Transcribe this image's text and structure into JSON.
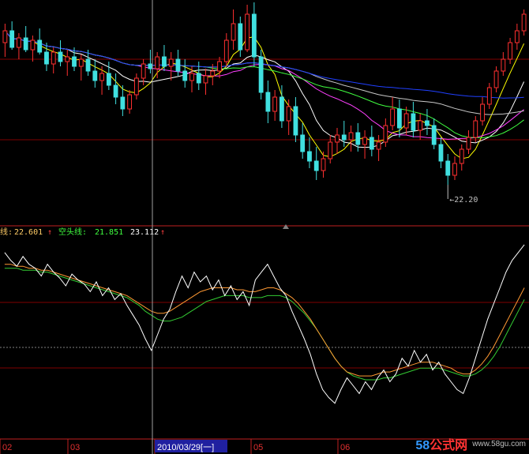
{
  "colors": {
    "background": "#000000",
    "grid_red": "#800000",
    "grid_gray": "#808080",
    "candle_up": "#ff3030",
    "candle_down": "#40e0e0",
    "ma_white": "#ffffff",
    "ma_yellow": "#ffff00",
    "ma_magenta": "#ff40ff",
    "ma_green": "#40ff40",
    "ma_gray": "#c8c8c8",
    "ma_blue": "#2040ff",
    "osc_white": "#ffffff",
    "osc_orange": "#ff9933",
    "osc_green": "#33cc33",
    "date_highlight": "#2020a0"
  },
  "indicator_bar": {
    "long_line_label": "线: ",
    "long_line_value": "22.601",
    "long_line_arrow": "↑",
    "short_line_label": "空头线: ",
    "short_line_value": "21.851",
    "third_value": "23.112",
    "third_arrow": "↑"
  },
  "price_annotation": "←22.20",
  "date_axis": {
    "labels": [
      "02",
      "03",
      "2010/03/29[一]",
      "05",
      "06"
    ],
    "highlighted": "2010/03/29[一]"
  },
  "watermark": {
    "brand_prefix": "58",
    "brand_suffix": "公式网",
    "url": "www.58gu.com"
  },
  "chart_data": [
    {
      "type": "candlestick",
      "title": "",
      "price_range": [
        20.5,
        30.0
      ],
      "lowest_marker": 22.2,
      "bars": [
        {
          "o": 28.2,
          "h": 29.0,
          "l": 27.6,
          "c": 28.7
        },
        {
          "o": 28.7,
          "h": 29.1,
          "l": 27.9,
          "c": 28.0
        },
        {
          "o": 28.0,
          "h": 28.6,
          "l": 27.5,
          "c": 28.4
        },
        {
          "o": 28.4,
          "h": 28.9,
          "l": 27.8,
          "c": 27.9
        },
        {
          "o": 27.9,
          "h": 28.5,
          "l": 27.4,
          "c": 28.3
        },
        {
          "o": 28.3,
          "h": 28.8,
          "l": 27.7,
          "c": 27.8
        },
        {
          "o": 27.8,
          "h": 28.2,
          "l": 27.0,
          "c": 27.3
        },
        {
          "o": 27.3,
          "h": 28.0,
          "l": 26.9,
          "c": 27.8
        },
        {
          "o": 27.8,
          "h": 28.3,
          "l": 27.2,
          "c": 27.4
        },
        {
          "o": 27.4,
          "h": 27.9,
          "l": 26.8,
          "c": 27.6
        },
        {
          "o": 27.6,
          "h": 28.0,
          "l": 27.0,
          "c": 27.2
        },
        {
          "o": 27.2,
          "h": 27.7,
          "l": 26.6,
          "c": 27.5
        },
        {
          "o": 27.5,
          "h": 27.9,
          "l": 26.8,
          "c": 27.0
        },
        {
          "o": 27.0,
          "h": 27.5,
          "l": 26.3,
          "c": 26.6
        },
        {
          "o": 26.6,
          "h": 27.2,
          "l": 26.0,
          "c": 26.9
        },
        {
          "o": 26.9,
          "h": 27.4,
          "l": 26.2,
          "c": 26.4
        },
        {
          "o": 26.4,
          "h": 26.9,
          "l": 25.6,
          "c": 25.9
        },
        {
          "o": 25.9,
          "h": 26.4,
          "l": 25.1,
          "c": 25.4
        },
        {
          "o": 25.4,
          "h": 26.2,
          "l": 25.2,
          "c": 26.0
        },
        {
          "o": 26.0,
          "h": 26.9,
          "l": 25.8,
          "c": 26.7
        },
        {
          "o": 26.7,
          "h": 27.5,
          "l": 26.4,
          "c": 27.3
        },
        {
          "o": 27.3,
          "h": 27.9,
          "l": 26.9,
          "c": 27.1
        },
        {
          "o": 27.1,
          "h": 27.8,
          "l": 26.7,
          "c": 27.6
        },
        {
          "o": 27.6,
          "h": 28.1,
          "l": 27.0,
          "c": 27.2
        },
        {
          "o": 27.2,
          "h": 27.8,
          "l": 26.6,
          "c": 27.5
        },
        {
          "o": 27.5,
          "h": 27.9,
          "l": 26.8,
          "c": 27.0
        },
        {
          "o": 27.0,
          "h": 27.5,
          "l": 26.3,
          "c": 26.6
        },
        {
          "o": 26.6,
          "h": 27.2,
          "l": 26.1,
          "c": 26.9
        },
        {
          "o": 26.9,
          "h": 27.4,
          "l": 26.2,
          "c": 26.5
        },
        {
          "o": 26.5,
          "h": 27.1,
          "l": 26.0,
          "c": 26.8
        },
        {
          "o": 26.8,
          "h": 27.3,
          "l": 26.4,
          "c": 27.0
        },
        {
          "o": 27.0,
          "h": 27.6,
          "l": 26.7,
          "c": 27.4
        },
        {
          "o": 27.4,
          "h": 28.6,
          "l": 27.2,
          "c": 28.3
        },
        {
          "o": 28.3,
          "h": 29.6,
          "l": 27.9,
          "c": 29.0
        },
        {
          "o": 29.0,
          "h": 29.3,
          "l": 27.6,
          "c": 27.9
        },
        {
          "o": 27.9,
          "h": 29.8,
          "l": 27.8,
          "c": 29.4
        },
        {
          "o": 29.4,
          "h": 29.9,
          "l": 27.2,
          "c": 27.6
        },
        {
          "o": 27.6,
          "h": 27.9,
          "l": 25.8,
          "c": 26.1
        },
        {
          "o": 26.1,
          "h": 26.6,
          "l": 24.8,
          "c": 25.3
        },
        {
          "o": 25.3,
          "h": 26.2,
          "l": 24.9,
          "c": 25.9
        },
        {
          "o": 25.9,
          "h": 26.4,
          "l": 24.6,
          "c": 24.9
        },
        {
          "o": 24.9,
          "h": 25.8,
          "l": 24.3,
          "c": 25.5
        },
        {
          "o": 25.5,
          "h": 25.9,
          "l": 24.0,
          "c": 24.3
        },
        {
          "o": 24.3,
          "h": 24.8,
          "l": 23.3,
          "c": 23.6
        },
        {
          "o": 23.6,
          "h": 24.2,
          "l": 22.9,
          "c": 23.2
        },
        {
          "o": 23.2,
          "h": 23.8,
          "l": 22.4,
          "c": 22.8
        },
        {
          "o": 22.8,
          "h": 23.6,
          "l": 22.5,
          "c": 23.3
        },
        {
          "o": 23.3,
          "h": 24.3,
          "l": 23.1,
          "c": 24.0
        },
        {
          "o": 24.0,
          "h": 24.6,
          "l": 23.5,
          "c": 24.3
        },
        {
          "o": 24.3,
          "h": 24.9,
          "l": 23.8,
          "c": 24.1
        },
        {
          "o": 24.1,
          "h": 24.7,
          "l": 23.6,
          "c": 24.4
        },
        {
          "o": 24.4,
          "h": 24.8,
          "l": 23.6,
          "c": 23.9
        },
        {
          "o": 23.9,
          "h": 24.5,
          "l": 23.3,
          "c": 24.2
        },
        {
          "o": 24.2,
          "h": 24.7,
          "l": 23.4,
          "c": 23.7
        },
        {
          "o": 23.7,
          "h": 24.3,
          "l": 23.2,
          "c": 24.0
        },
        {
          "o": 24.0,
          "h": 25.0,
          "l": 23.8,
          "c": 24.7
        },
        {
          "o": 24.7,
          "h": 25.9,
          "l": 24.5,
          "c": 25.4
        },
        {
          "o": 25.4,
          "h": 25.8,
          "l": 24.2,
          "c": 24.6
        },
        {
          "o": 24.6,
          "h": 25.5,
          "l": 24.3,
          "c": 25.2
        },
        {
          "o": 25.2,
          "h": 25.7,
          "l": 24.2,
          "c": 24.5
        },
        {
          "o": 24.5,
          "h": 25.2,
          "l": 24.1,
          "c": 24.9
        },
        {
          "o": 24.9,
          "h": 25.4,
          "l": 24.3,
          "c": 24.7
        },
        {
          "o": 24.7,
          "h": 25.0,
          "l": 23.7,
          "c": 23.9
        },
        {
          "o": 23.9,
          "h": 24.2,
          "l": 22.9,
          "c": 23.2
        },
        {
          "o": 23.2,
          "h": 23.5,
          "l": 22.2,
          "c": 22.6
        },
        {
          "o": 22.6,
          "h": 23.4,
          "l": 22.4,
          "c": 23.1
        },
        {
          "o": 23.1,
          "h": 23.9,
          "l": 22.8,
          "c": 23.7
        },
        {
          "o": 23.7,
          "h": 24.5,
          "l": 23.5,
          "c": 24.2
        },
        {
          "o": 24.2,
          "h": 25.1,
          "l": 24.0,
          "c": 24.9
        },
        {
          "o": 24.9,
          "h": 25.9,
          "l": 24.7,
          "c": 25.6
        },
        {
          "o": 25.6,
          "h": 26.5,
          "l": 25.4,
          "c": 26.3
        },
        {
          "o": 26.3,
          "h": 27.2,
          "l": 26.1,
          "c": 27.0
        },
        {
          "o": 27.0,
          "h": 27.8,
          "l": 26.8,
          "c": 27.5
        },
        {
          "o": 27.5,
          "h": 28.4,
          "l": 27.3,
          "c": 28.2
        },
        {
          "o": 28.2,
          "h": 29.0,
          "l": 27.9,
          "c": 28.7
        },
        {
          "o": 28.7,
          "h": 29.6,
          "l": 28.5,
          "c": 29.4
        }
      ],
      "moving_averages": [
        {
          "color_key": "ma_yellow",
          "period": 5
        },
        {
          "color_key": "ma_white",
          "period": 10
        },
        {
          "color_key": "ma_magenta",
          "period": 20
        },
        {
          "color_key": "ma_green",
          "period": 30
        },
        {
          "color_key": "ma_gray",
          "period": 45
        },
        {
          "color_key": "ma_blue",
          "period": 70
        }
      ]
    },
    {
      "type": "line",
      "title": "",
      "ylim": [
        0,
        100
      ],
      "reference_level": 50,
      "series": [
        {
          "color_key": "osc_white",
          "values": [
            92,
            88,
            85,
            90,
            86,
            84,
            80,
            86,
            82,
            79,
            75,
            81,
            78,
            76,
            72,
            77,
            70,
            74,
            68,
            71,
            65,
            60,
            55,
            48,
            42,
            50,
            58,
            63,
            72,
            80,
            74,
            82,
            77,
            80,
            73,
            78,
            70,
            75,
            68,
            72,
            65,
            78,
            82,
            86,
            80,
            74,
            70,
            62,
            55,
            48,
            40,
            30,
            22,
            18,
            15,
            22,
            28,
            24,
            20,
            26,
            22,
            28,
            32,
            26,
            30,
            38,
            34,
            42,
            36,
            40,
            32,
            36,
            30,
            26,
            22,
            20,
            28,
            38,
            48,
            58,
            66,
            74,
            82,
            88,
            92,
            96
          ]
        },
        {
          "color_key": "osc_orange",
          "values": [
            86,
            86,
            85,
            85,
            84,
            84,
            83,
            83,
            82,
            81,
            80,
            79,
            78,
            77,
            76,
            75,
            74,
            73,
            72,
            71,
            70,
            68,
            66,
            64,
            62,
            61,
            61,
            62,
            64,
            66,
            68,
            70,
            72,
            73,
            74,
            74,
            74,
            74,
            73,
            73,
            72,
            72,
            73,
            74,
            74,
            73,
            71,
            69,
            66,
            62,
            58,
            53,
            48,
            43,
            38,
            34,
            31,
            30,
            29,
            29,
            29,
            30,
            31,
            31,
            32,
            33,
            34,
            35,
            36,
            36,
            36,
            35,
            34,
            33,
            31,
            30,
            30,
            32,
            35,
            39,
            44,
            50,
            56,
            62,
            68,
            74
          ]
        },
        {
          "color_key": "osc_green",
          "values": [
            84,
            84,
            84,
            83,
            83,
            83,
            82,
            82,
            81,
            80,
            79,
            78,
            77,
            76,
            75,
            74,
            73,
            72,
            71,
            70,
            69,
            67,
            65,
            62,
            60,
            58,
            57,
            57,
            58,
            59,
            61,
            63,
            65,
            67,
            68,
            69,
            70,
            70,
            70,
            70,
            69,
            69,
            69,
            70,
            70,
            70,
            69,
            67,
            64,
            61,
            57,
            53,
            48,
            43,
            38,
            34,
            31,
            29,
            28,
            27,
            27,
            27,
            28,
            28,
            29,
            30,
            31,
            32,
            33,
            33,
            33,
            33,
            32,
            31,
            30,
            29,
            29,
            30,
            32,
            35,
            39,
            44,
            50,
            56,
            62,
            68
          ]
        }
      ]
    }
  ]
}
